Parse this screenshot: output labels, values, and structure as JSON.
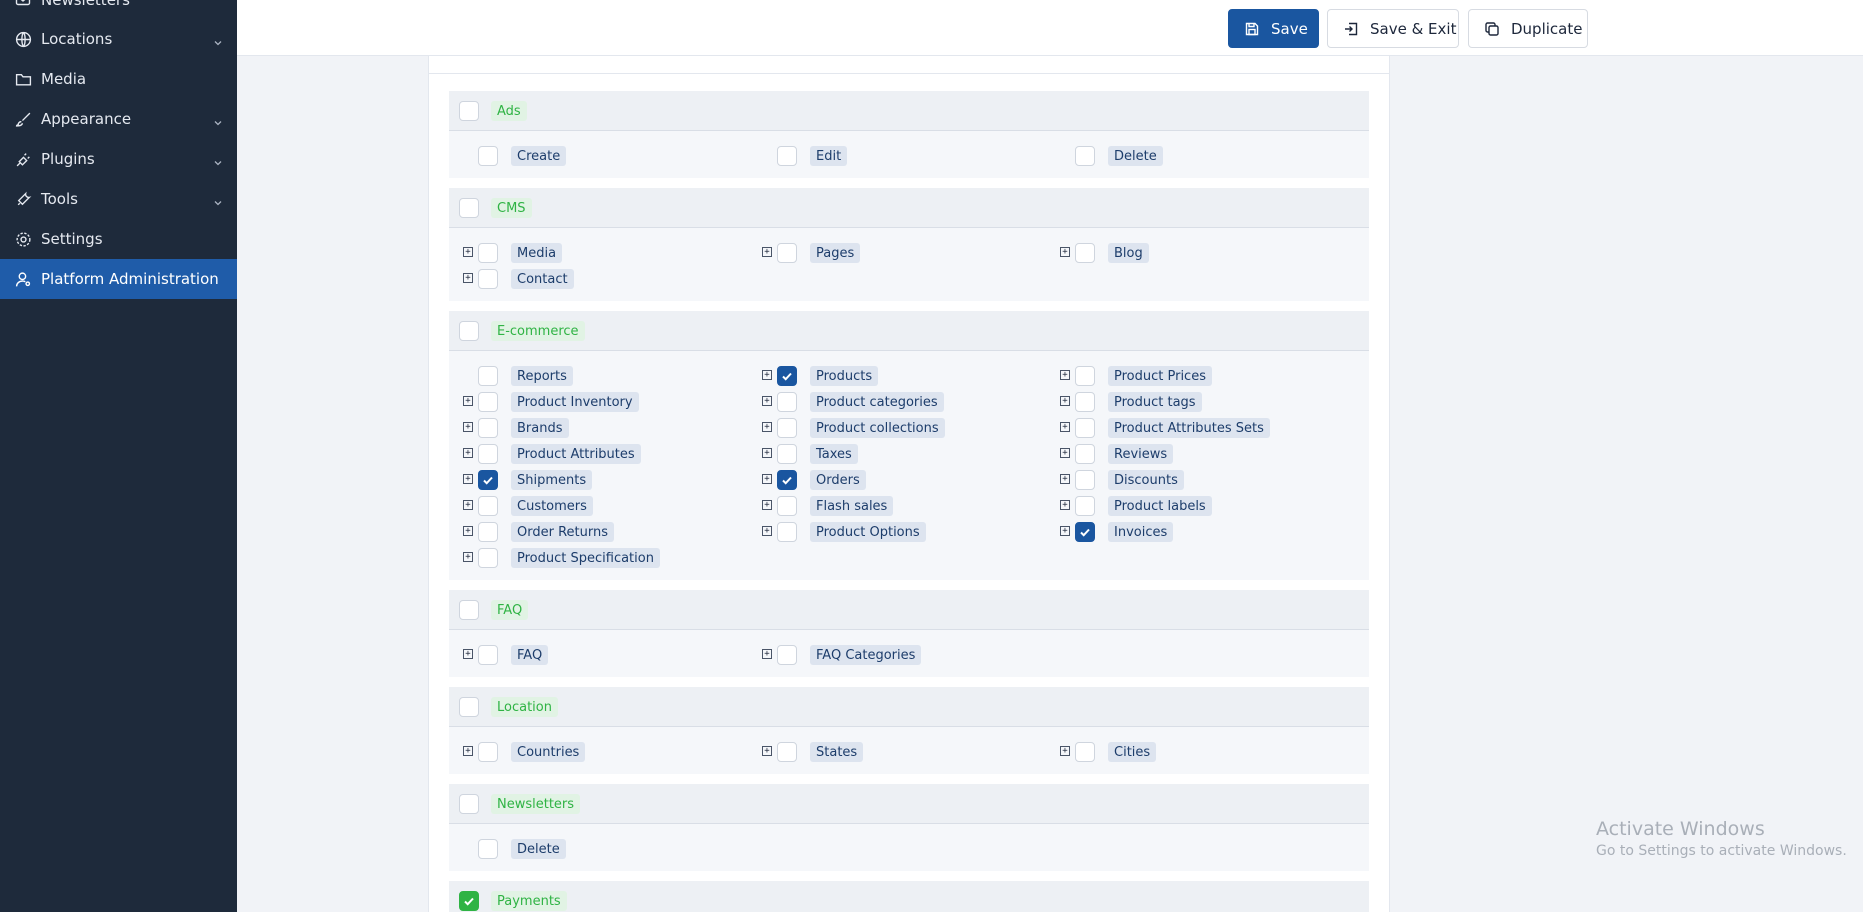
{
  "sidebar": {
    "items": [
      {
        "label": "Newsletters",
        "icon": "mail-icon",
        "active": false
      },
      {
        "label": "Locations",
        "icon": "globe-icon",
        "active": false
      },
      {
        "label": "Media",
        "icon": "folder-icon",
        "active": false
      },
      {
        "label": "Appearance",
        "icon": "brush-icon",
        "active": false
      },
      {
        "label": "Plugins",
        "icon": "plug-icon",
        "active": false
      },
      {
        "label": "Tools",
        "icon": "tool-icon",
        "active": false
      },
      {
        "label": "Settings",
        "icon": "gear-icon",
        "active": false
      },
      {
        "label": "Platform Administration",
        "icon": "user-cog-icon",
        "active": true
      }
    ]
  },
  "toolbar": {
    "save_label": "Save",
    "save_exit_label": "Save & Exit",
    "duplicate_label": "Duplicate"
  },
  "groups": [
    {
      "name": "Ads",
      "checked": false,
      "items": [
        {
          "label": "Create",
          "checked": false,
          "expandable": false
        },
        {
          "label": "Edit",
          "checked": false,
          "expandable": false
        },
        {
          "label": "Delete",
          "checked": false,
          "expandable": false
        }
      ]
    },
    {
      "name": "CMS",
      "checked": false,
      "items": [
        {
          "label": "Media",
          "checked": false,
          "expandable": true
        },
        {
          "label": "Pages",
          "checked": false,
          "expandable": true
        },
        {
          "label": "Blog",
          "checked": false,
          "expandable": true
        },
        {
          "label": "Contact",
          "checked": false,
          "expandable": true
        }
      ]
    },
    {
      "name": "E-commerce",
      "checked": false,
      "items": [
        {
          "label": "Reports",
          "checked": false,
          "expandable": false
        },
        {
          "label": "Products",
          "checked": true,
          "expandable": true
        },
        {
          "label": "Product Prices",
          "checked": false,
          "expandable": true
        },
        {
          "label": "Product Inventory",
          "checked": false,
          "expandable": true
        },
        {
          "label": "Product categories",
          "checked": false,
          "expandable": true
        },
        {
          "label": "Product tags",
          "checked": false,
          "expandable": true
        },
        {
          "label": "Brands",
          "checked": false,
          "expandable": true
        },
        {
          "label": "Product collections",
          "checked": false,
          "expandable": true
        },
        {
          "label": "Product Attributes Sets",
          "checked": false,
          "expandable": true
        },
        {
          "label": "Product Attributes",
          "checked": false,
          "expandable": true
        },
        {
          "label": "Taxes",
          "checked": false,
          "expandable": true
        },
        {
          "label": "Reviews",
          "checked": false,
          "expandable": true
        },
        {
          "label": "Shipments",
          "checked": true,
          "expandable": true
        },
        {
          "label": "Orders",
          "checked": true,
          "expandable": true
        },
        {
          "label": "Discounts",
          "checked": false,
          "expandable": true
        },
        {
          "label": "Customers",
          "checked": false,
          "expandable": true
        },
        {
          "label": "Flash sales",
          "checked": false,
          "expandable": true
        },
        {
          "label": "Product labels",
          "checked": false,
          "expandable": true
        },
        {
          "label": "Order Returns",
          "checked": false,
          "expandable": true
        },
        {
          "label": "Product Options",
          "checked": false,
          "expandable": true
        },
        {
          "label": "Invoices",
          "checked": true,
          "expandable": true
        },
        {
          "label": "Product Specification",
          "checked": false,
          "expandable": true
        }
      ]
    },
    {
      "name": "FAQ",
      "checked": false,
      "items": [
        {
          "label": "FAQ",
          "checked": false,
          "expandable": true
        },
        {
          "label": "FAQ Categories",
          "checked": false,
          "expandable": true
        }
      ]
    },
    {
      "name": "Location",
      "checked": false,
      "items": [
        {
          "label": "Countries",
          "checked": false,
          "expandable": true
        },
        {
          "label": "States",
          "checked": false,
          "expandable": true
        },
        {
          "label": "Cities",
          "checked": false,
          "expandable": true
        }
      ]
    },
    {
      "name": "Newsletters",
      "checked": false,
      "items": [
        {
          "label": "Delete",
          "checked": false,
          "expandable": false
        }
      ]
    },
    {
      "name": "Payments",
      "checked": true,
      "items": []
    }
  ],
  "watermark": {
    "title": "Activate Windows",
    "subtitle": "Go to Settings to activate Windows."
  },
  "colors": {
    "sidebar_bg": "#1e2a3b",
    "active_item": "#1f5ca9",
    "primary_button": "#1a56a0",
    "group_tag_green": "#2fb344",
    "item_tag_blue": "#dde4ef"
  }
}
